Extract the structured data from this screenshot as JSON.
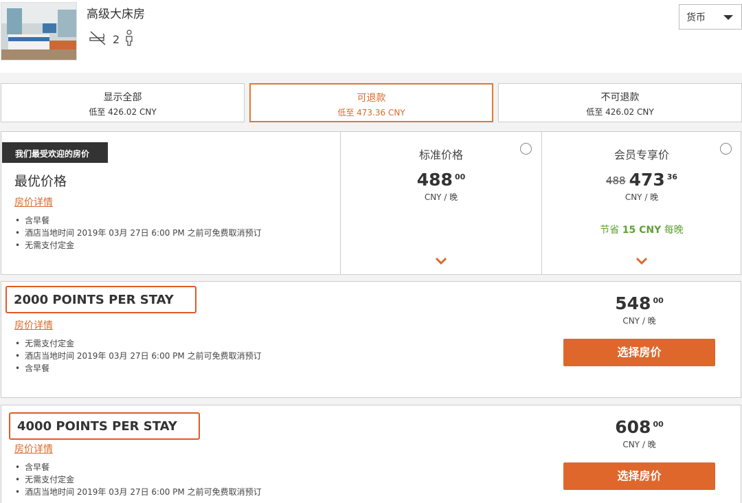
{
  "room": {
    "title": "高级大床房",
    "occupancy": "2",
    "smoking_icon": "no-smoking-icon",
    "guest_icon": "person-icon"
  },
  "currency": {
    "label": "货币"
  },
  "filters": [
    {
      "title": "显示全部",
      "sub": "低至 426.02 CNY",
      "active": false
    },
    {
      "title": "可退款",
      "sub": "低至 473.36 CNY",
      "active": true
    },
    {
      "title": "不可退款",
      "sub": "低至 426.02 CNY",
      "active": false
    }
  ],
  "best_rate": {
    "badge": "我们最受欢迎的房价",
    "title": "最优价格",
    "detail_link": "房价详情",
    "bullets": [
      "含早餐",
      "酒店当地时间 2019年 03月 27日 6:00 PM 之前可免费取消预订",
      "无需支付定金"
    ],
    "standard": {
      "title": "标准价格",
      "price_int": "488",
      "price_dec": "00",
      "unit": "CNY / 晚"
    },
    "member": {
      "title": "会员专享价",
      "strike": "488",
      "price_int": "473",
      "price_dec": "36",
      "unit": "CNY / 晚",
      "save_prefix": "节省 ",
      "save_amount": "15 CNY",
      "save_suffix": " 每晚"
    }
  },
  "rates": [
    {
      "title": "2000 POINTS PER STAY",
      "detail_link": "房价详情",
      "bullets": [
        "无需支付定金",
        "酒店当地时间 2019年 03月 27日 6:00 PM 之前可免费取消预订",
        "含早餐"
      ],
      "price_int": "548",
      "price_dec": "00",
      "unit": "CNY / 晚",
      "button": "选择房价"
    },
    {
      "title": "4000 POINTS PER STAY",
      "detail_link": "房价详情",
      "bullets": [
        "含早餐",
        "无需支付定金",
        "酒店当地时间 2019年 03月 27日 6:00 PM 之前可免费取消预订"
      ],
      "price_int": "608",
      "price_dec": "00",
      "unit": "CNY / 晚",
      "button": "选择房价"
    }
  ],
  "colors": {
    "accent": "#e0672c",
    "save_green": "#5ea135",
    "badge_bg": "#333333"
  }
}
